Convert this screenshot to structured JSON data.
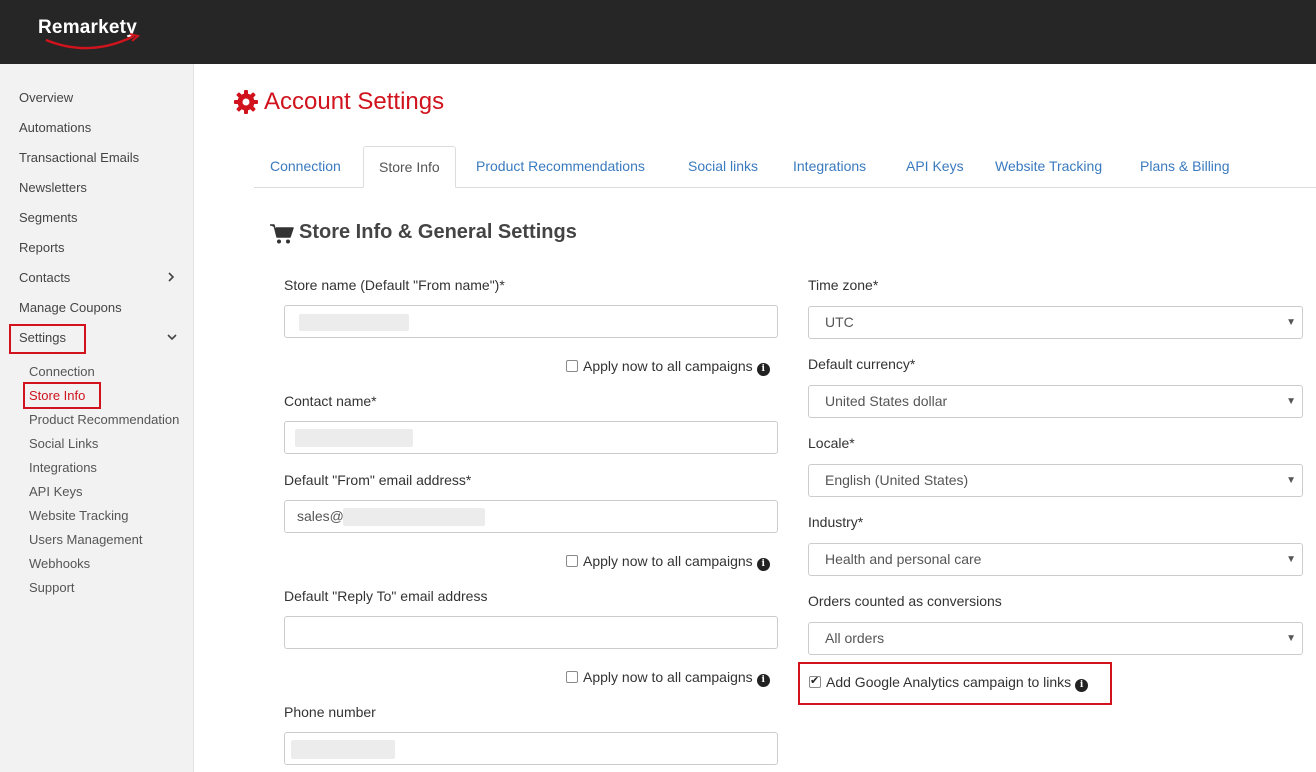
{
  "brand": {
    "name": "Remarkety",
    "accent": "#d0131d"
  },
  "sidebar": {
    "items": [
      {
        "label": "Overview"
      },
      {
        "label": "Automations"
      },
      {
        "label": "Transactional Emails"
      },
      {
        "label": "Newsletters"
      },
      {
        "label": "Segments"
      },
      {
        "label": "Reports"
      },
      {
        "label": "Contacts",
        "icon": "chevron-right-icon"
      },
      {
        "label": "Manage Coupons"
      },
      {
        "label": "Settings",
        "icon": "chevron-down-icon"
      }
    ],
    "sub_items": [
      {
        "label": "Connection"
      },
      {
        "label": "Store Info"
      },
      {
        "label": "Product Recommendation"
      },
      {
        "label": "Social Links"
      },
      {
        "label": "Integrations"
      },
      {
        "label": "API Keys"
      },
      {
        "label": "Website Tracking"
      },
      {
        "label": "Users Management"
      },
      {
        "label": "Webhooks"
      },
      {
        "label": "Support"
      }
    ]
  },
  "page": {
    "title": "Account Settings",
    "title_icon": "gear-icon"
  },
  "tabs": [
    {
      "label": "Connection"
    },
    {
      "label": "Store Info",
      "active": true
    },
    {
      "label": "Product Recommendations"
    },
    {
      "label": "Social links"
    },
    {
      "label": "Integrations"
    },
    {
      "label": "API Keys"
    },
    {
      "label": "Website Tracking"
    },
    {
      "label": "Plans & Billing"
    }
  ],
  "section": {
    "title": "Store Info & General Settings",
    "icon": "cart-icon"
  },
  "form_left": {
    "store_name_label": "Store name (Default \"From name\")*",
    "contact_name_label": "Contact name*",
    "from_email_label": "Default \"From\" email address*",
    "from_email_value": "sales@",
    "reply_to_label": "Default \"Reply To\" email address",
    "phone_label": "Phone number",
    "apply_label": "Apply now to all campaigns"
  },
  "form_right": {
    "timezone_label": "Time zone*",
    "timezone_value": "UTC",
    "currency_label": "Default currency*",
    "currency_value": "United States dollar",
    "locale_label": "Locale*",
    "locale_value": "English (United States)",
    "industry_label": "Industry*",
    "industry_value": "Health and personal care",
    "orders_label": "Orders counted as conversions",
    "orders_value": "All orders",
    "ga_label": "Add Google Analytics campaign to links",
    "ga_checked": true
  }
}
